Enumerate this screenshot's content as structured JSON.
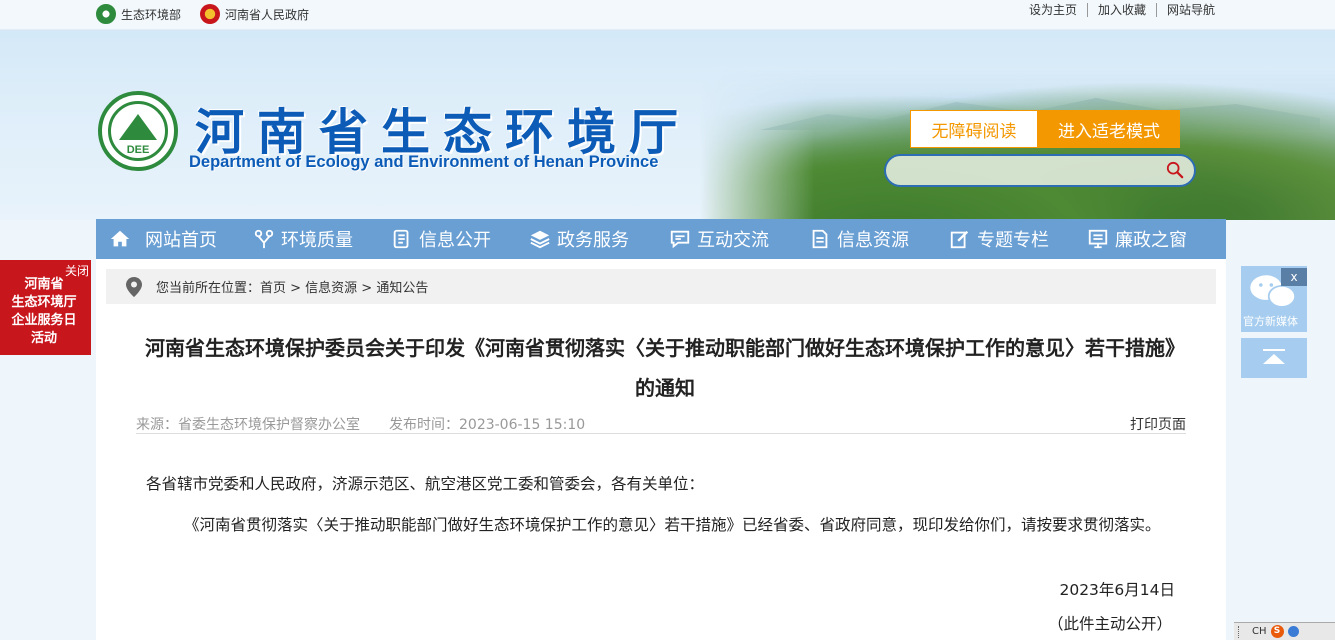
{
  "topbar": {
    "links": [
      "生态环境部",
      "河南省人民政府"
    ],
    "right": [
      "设为主页",
      "加入收藏",
      "网站导航"
    ]
  },
  "header": {
    "logo_text": "DEE",
    "title_cn": "河南省生态环境厅",
    "title_en": "Department of Ecology and Environment of Henan Province",
    "accessible_reading": "无障碍阅读",
    "elder_mode": "进入适老模式",
    "search_placeholder": ""
  },
  "nav": {
    "items": [
      "网站首页",
      "环境质量",
      "信息公开",
      "政务服务",
      "互动交流",
      "信息资源",
      "专题专栏",
      "廉政之窗"
    ]
  },
  "breadcrumb": "您当前所在位置：首页 > 信息资源 > 通知公告",
  "article": {
    "title_line1": "河南省生态环境保护委员会关于印发《河南省贯彻落实〈关于推动职能部门做好生态环境保护工作的意见〉若干措施》",
    "title_line2": "的通知",
    "source": "来源：省委生态环境保护督察办公室",
    "time": "发布时间：2023-06-15 15:10",
    "print": "打印页面",
    "p1": "各省辖市党委和人民政府，济源示范区、航空港区党工委和管委会，各有关单位：",
    "p2": "《河南省贯彻落实〈关于推动职能部门做好生态环境保护工作的意见〉若干措施》已经省委、省政府同意，现印发给你们，请按要求贯彻落实。",
    "date": "2023年6月14日",
    "public": "（此件主动公开）"
  },
  "left_float": {
    "close": "关闭",
    "text": "河南省\n生态环境厅\n企业服务日\n活动"
  },
  "right_float": {
    "close": "x",
    "label": "官方新媒体"
  },
  "ime": {
    "lang": "CH"
  },
  "colors": {
    "brand_blue": "#0b5bb7",
    "nav_blue": "#6a9fd4",
    "orange": "#f39800",
    "banner_red": "#c8161d"
  }
}
